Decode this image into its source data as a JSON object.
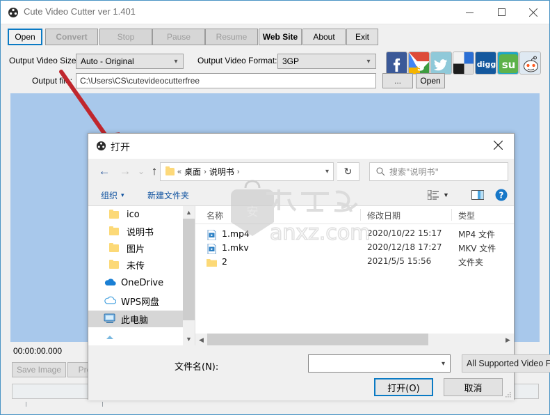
{
  "app": {
    "title": "Cute Video Cutter ver 1.401",
    "icon": "film-reel-icon",
    "window_controls": {
      "minimize": "─",
      "maximize": "□",
      "close": "✕"
    },
    "toolbar": {
      "buttons": [
        {
          "label": "Open",
          "state": "focused"
        },
        {
          "label": "Convert",
          "state": "disabled-bold"
        },
        {
          "label": "Stop",
          "state": "disabled"
        },
        {
          "label": "Pause",
          "state": "disabled"
        },
        {
          "label": "Resume",
          "state": "disabled"
        },
        {
          "label": "Web Site",
          "state": "enabled-bold"
        },
        {
          "label": "About",
          "state": "enabled"
        },
        {
          "label": "Exit",
          "state": "enabled"
        }
      ],
      "social": [
        {
          "name": "facebook-icon",
          "color": "#3b5998"
        },
        {
          "name": "google-plus-icon",
          "color": "#dd4b39"
        },
        {
          "name": "twitter-icon",
          "color": "#7fc3d6"
        },
        {
          "name": "windows-icon",
          "color": "#2b6fd4"
        },
        {
          "name": "digg-icon",
          "color": "#14589e",
          "label": "digg"
        },
        {
          "name": "stumbleupon-icon",
          "color": "#3aaa35",
          "label": "su"
        },
        {
          "name": "reddit-icon",
          "color": "#ff4500"
        }
      ]
    },
    "fields": {
      "size_label": "Output Video Size:",
      "size_value": "Auto - Original",
      "format_label": "Output Video Format:",
      "format_value": "3GP",
      "file_label": "Output file:",
      "file_value": "C:\\Users\\CS\\cutevideocutterfree",
      "browse_label": "...",
      "open_label": "Open"
    },
    "player": {
      "timecode": "00:00:00.000",
      "save_image_label": "Save Image",
      "previous_label": "Previous"
    }
  },
  "dialog": {
    "title": "打开",
    "icon": "film-reel-icon",
    "close": "✕",
    "nav": {
      "back": "←",
      "forward": "→",
      "recent": "⌄",
      "up": "↑",
      "refresh": "↻",
      "breadcrumb": [
        "桌面",
        "说明书"
      ],
      "breadcrumb_prefix": "«",
      "breadcrumb_sep": "›",
      "search_placeholder": "搜索\"说明书\""
    },
    "toolbar": {
      "organize": "组织",
      "new_folder": "新建文件夹",
      "view_icon": "list-view-icon",
      "preview_icon": "preview-pane-icon",
      "help_icon": "help-icon"
    },
    "sidebar": {
      "items": [
        {
          "label": "ico",
          "icon": "folder-icon",
          "selected": false
        },
        {
          "label": "说明书",
          "icon": "folder-icon",
          "selected": false
        },
        {
          "label": "图片",
          "icon": "folder-icon",
          "selected": false
        },
        {
          "label": "未传",
          "icon": "folder-icon",
          "selected": false
        },
        {
          "label": "OneDrive",
          "icon": "onedrive-icon",
          "selected": false
        },
        {
          "label": "WPS网盘",
          "icon": "cloud-icon",
          "selected": false
        },
        {
          "label": "此电脑",
          "icon": "computer-icon",
          "selected": true
        }
      ]
    },
    "filelist": {
      "columns": [
        "名称",
        "修改日期",
        "类型"
      ],
      "rows": [
        {
          "name": "1.mp4",
          "date": "2020/10/22 15:17",
          "type": "MP4 文件",
          "icon": "video-file-icon"
        },
        {
          "name": "1.mkv",
          "date": "2020/12/18 17:27",
          "type": "MKV 文件",
          "icon": "video-file-icon"
        },
        {
          "name": "2",
          "date": "2021/5/5 15:56",
          "type": "文件夹",
          "icon": "folder-icon"
        }
      ]
    },
    "footer": {
      "filename_label": "文件名(N):",
      "filename_value": "",
      "filter_value": "All Supported Video Format",
      "open_button": "打开(O)",
      "cancel_button": "取消"
    }
  },
  "watermark": {
    "text": "anxz.com"
  },
  "annotation": {
    "type": "red-arrow",
    "color": "#c0272d"
  }
}
